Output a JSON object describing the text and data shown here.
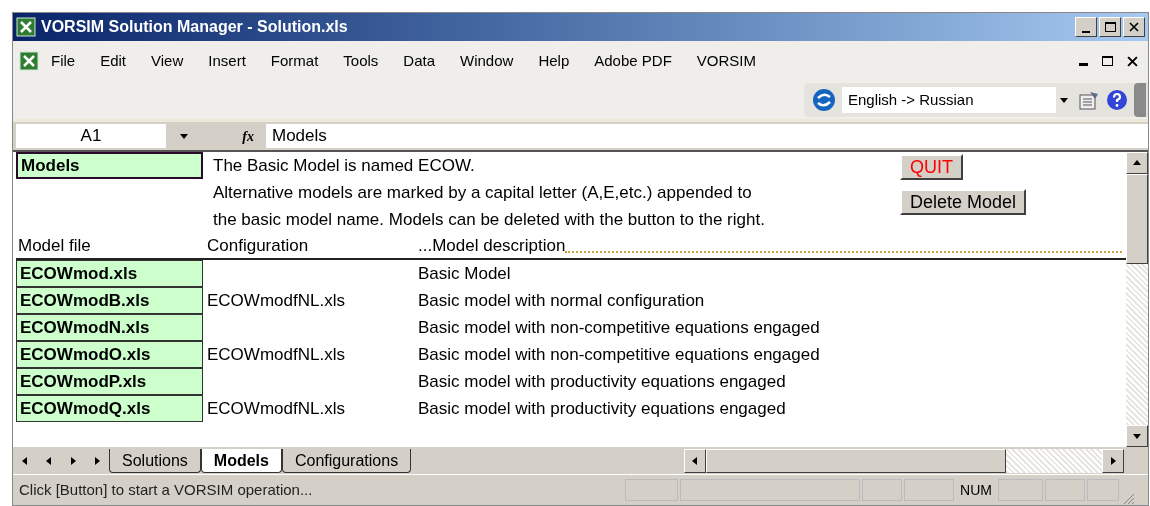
{
  "window": {
    "title": "VORSIM Solution Manager - Solution.xls"
  },
  "menu": [
    "File",
    "Edit",
    "View",
    "Insert",
    "Format",
    "Tools",
    "Data",
    "Window",
    "Help",
    "Adobe PDF",
    "VORSIM"
  ],
  "translator": {
    "value": "English -> Russian"
  },
  "formula_bar": {
    "cell": "A1",
    "function_label": "fx",
    "value": "Models"
  },
  "sheet": {
    "title_cell": {
      "text": "Models",
      "selected": true
    },
    "notes": [
      "The Basic Model is named ECOW.",
      "Alternative models are marked by a capital letter (A,E,etc.) appended to",
      "the basic model name.  Models can be deleted with the button to the right."
    ],
    "columns": [
      "Model file",
      "Configuration",
      "...Model description"
    ],
    "rows": [
      {
        "file": "ECOWmod.xls",
        "config": "",
        "description": "Basic Model"
      },
      {
        "file": "ECOWmodB.xls",
        "config": "ECOWmodfNL.xls",
        "description": "Basic model with normal configuration"
      },
      {
        "file": "ECOWmodN.xls",
        "config": "",
        "description": "Basic model with non-competitive equations engaged"
      },
      {
        "file": "ECOWmodO.xls",
        "config": "ECOWmodfNL.xls",
        "description": "Basic model with non-competitive equations engaged"
      },
      {
        "file": "ECOWmodP.xls",
        "config": "",
        "description": "Basic model with productivity equations engaged"
      },
      {
        "file": "ECOWmodQ.xls",
        "config": "ECOWmodfNL.xls",
        "description": "Basic model with productivity equations engaged"
      }
    ],
    "buttons": [
      {
        "label": "QUIT",
        "kind": "danger"
      },
      {
        "label": "Delete Model",
        "kind": "normal"
      }
    ]
  },
  "sheet_tabs": [
    {
      "label": "Solutions",
      "selected": false
    },
    {
      "label": "Models",
      "selected": true
    },
    {
      "label": "Configurations",
      "selected": false
    }
  ],
  "status_bar": {
    "message": "Click [Button] to start a VORSIM operation...",
    "indicator": "NUM"
  }
}
